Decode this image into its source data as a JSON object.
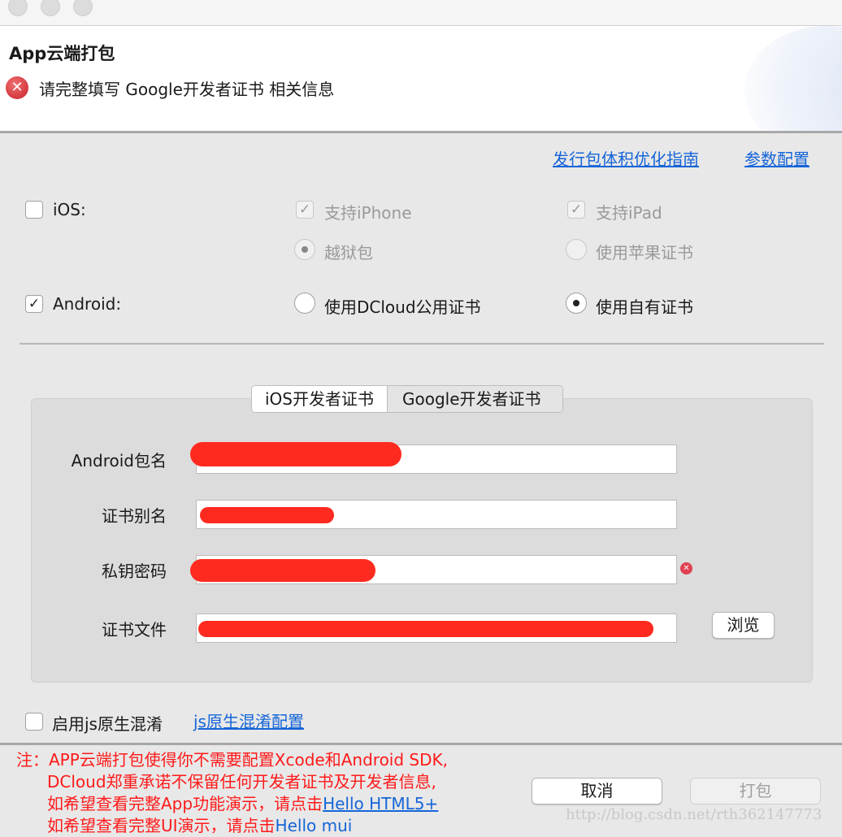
{
  "window": {
    "title": "App云端打包",
    "error_message": "请完整填写 Google开发者证书 相关信息"
  },
  "links": {
    "size_guide": "发行包体积优化指南",
    "param_config": "参数配置"
  },
  "platforms": {
    "ios": {
      "label": "iOS:",
      "checked": false,
      "iphone": "支持iPhone",
      "ipad": "支持iPad",
      "jailbreak": "越狱包",
      "apple_cert": "使用苹果证书"
    },
    "android": {
      "label": "Android:",
      "checked": true,
      "dcloud_cert": "使用DCloud公用证书",
      "own_cert": "使用自有证书"
    }
  },
  "tabs": [
    "iOS开发者证书",
    "Google开发者证书"
  ],
  "form": {
    "package_name_label": "Android包名",
    "alias_label": "证书别名",
    "password_label": "私钥密码",
    "file_label": "证书文件",
    "browse": "浏览"
  },
  "obfuscation": {
    "label": "启用js原生混淆",
    "link": "js原生混淆配置"
  },
  "note": {
    "line1": "注：APP云端打包使得你不需要配置Xcode和Android SDK,",
    "line2": "DCloud郑重承诺不保留任何开发者证书及开发者信息,",
    "line3": "如希望查看完整App功能演示，请点击",
    "link1": "Hello HTML5+",
    "line4": "如希望查看完整UI演示，请点击",
    "link2": "Hello mui"
  },
  "buttons": {
    "cancel": "取消",
    "pack": "打包"
  },
  "watermark": "http://blog.csdn.net/rth362147773"
}
